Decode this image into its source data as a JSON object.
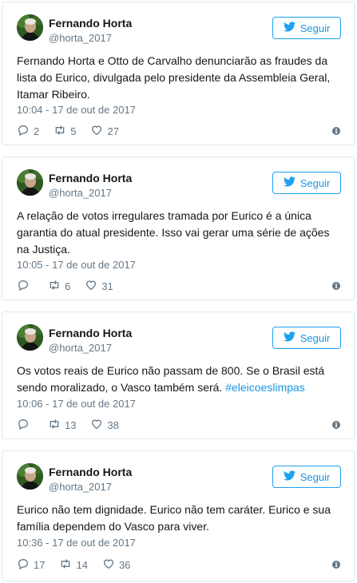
{
  "colors": {
    "accent": "#1da1f2",
    "muted": "#657786",
    "text": "#14171a",
    "border": "#e1e8ed"
  },
  "tweets": [
    {
      "author_name": "Fernando Horta",
      "author_handle": "@horta_2017",
      "follow_label": "Seguir",
      "text": "Fernando Horta e Otto de Carvalho denunciarão as fraudes da lista do Eurico, divulgada pelo presidente da Assembleia Geral, Itamar Ribeiro.",
      "hashtag": "",
      "timestamp": "10:04 - 17 de out de 2017",
      "replies": "2",
      "retweets": "5",
      "likes": "27",
      "info_icon": "info-icon"
    },
    {
      "author_name": "Fernando Horta",
      "author_handle": "@horta_2017",
      "follow_label": "Seguir",
      "text": "A relação de votos irregulares tramada por Eurico é a única garantia do atual presidente. Isso vai gerar uma série de ações na Justiça.",
      "hashtag": "",
      "timestamp": "10:05 - 17 de out de 2017",
      "replies": "",
      "retweets": "6",
      "likes": "31",
      "info_icon": "info-icon"
    },
    {
      "author_name": "Fernando Horta",
      "author_handle": "@horta_2017",
      "follow_label": "Seguir",
      "text": "Os votos reais de Eurico não passam de 800. Se o Brasil está sendo moralizado, o Vasco também será.",
      "hashtag": "#eleicoeslimpas",
      "timestamp": "10:06 - 17 de out de 2017",
      "replies": "",
      "retweets": "13",
      "likes": "38",
      "info_icon": "info-icon"
    },
    {
      "author_name": "Fernando Horta",
      "author_handle": "@horta_2017",
      "follow_label": "Seguir",
      "text": "Eurico não tem dignidade. Eurico não tem caráter. Eurico e sua família dependem do Vasco para viver.",
      "hashtag": "",
      "timestamp": "10:36 - 17 de out de 2017",
      "replies": "17",
      "retweets": "14",
      "likes": "36",
      "info_icon": "info-icon"
    }
  ]
}
